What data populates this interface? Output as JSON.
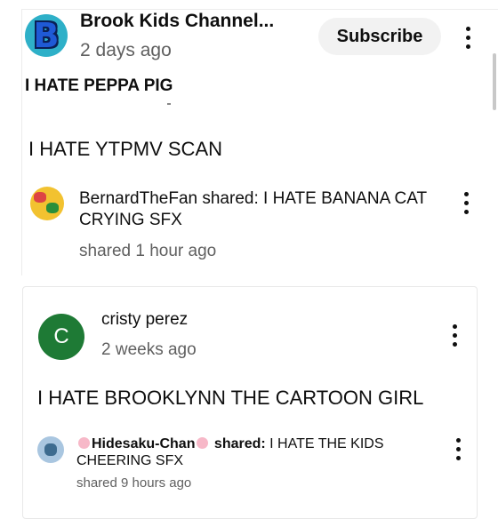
{
  "post": {
    "channel_name": "Brook Kids Channel...",
    "time": "2 days ago",
    "subscribe_label": "Subscribe",
    "logo_letter": "B",
    "title": "I HATE PEPPA PIG",
    "body": "I HATE YTPMV SCAN"
  },
  "share1": {
    "user": "BernardTheFan shared:",
    "text": " I HATE BANANA CAT CRYING SFX",
    "time": "shared 1 hour ago"
  },
  "comment": {
    "avatar_letter": "C",
    "author": "cristy perez",
    "time": "2 weeks ago",
    "body": "I HATE BROOKLYNN THE CARTOON GIRL",
    "avatar_color": "#1e7a35"
  },
  "share2": {
    "user": "Hidesaku-Chan",
    "shared_label": " shared:",
    "text": " I HATE THE KIDS CHEERING SFX",
    "time": "shared 9 hours ago"
  },
  "colors": {
    "subscribe_bg": "#f2f2f2",
    "secondary_text": "#606060"
  }
}
